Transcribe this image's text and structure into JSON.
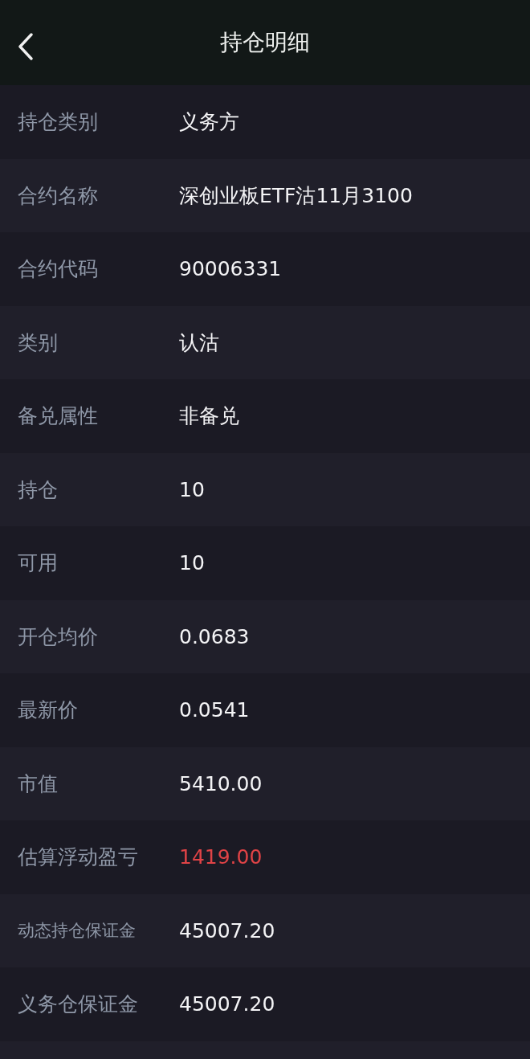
{
  "header": {
    "title": "持仓明细"
  },
  "rows": [
    {
      "label": "持仓类别",
      "value": "义务方",
      "kind": "plain"
    },
    {
      "label": "合约名称",
      "value": "深创业板ETF沽11月3100",
      "kind": "plain"
    },
    {
      "label": "合约代码",
      "value": "90006331",
      "kind": "plain"
    },
    {
      "label": "类别",
      "value": "认沽",
      "kind": "plain"
    },
    {
      "label": "备兑属性",
      "value": "非备兑",
      "kind": "plain"
    },
    {
      "label": "持仓",
      "value": "10",
      "kind": "plain"
    },
    {
      "label": "可用",
      "value": "10",
      "kind": "plain"
    },
    {
      "label": "开仓均价",
      "value": "0.0683",
      "kind": "plain"
    },
    {
      "label": "最新价",
      "value": "0.0541",
      "kind": "plain"
    },
    {
      "label": "市值",
      "value": "5410.00",
      "kind": "plain"
    },
    {
      "label": "估算浮动盈亏",
      "value": "1419.00",
      "kind": "profit"
    },
    {
      "label": "动态持仓保证金",
      "value": "45007.20",
      "kind": "plain"
    },
    {
      "label": "义务仓保证金",
      "value": "45007.20",
      "kind": "plain"
    }
  ]
}
